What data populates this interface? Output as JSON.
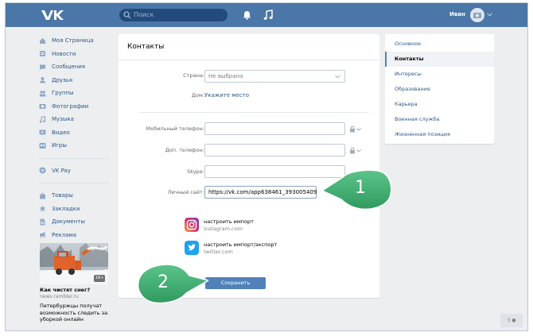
{
  "header": {
    "search_placeholder": "Поиск",
    "username": "Иван",
    "accent": "#4a76a8"
  },
  "leftnav": {
    "group1": [
      {
        "label": "Моя Страница",
        "icon": "home-icon"
      },
      {
        "label": "Новости",
        "icon": "news-icon"
      },
      {
        "label": "Сообщения",
        "icon": "messages-icon"
      },
      {
        "label": "Друзья",
        "icon": "friends-icon"
      },
      {
        "label": "Группы",
        "icon": "groups-icon"
      },
      {
        "label": "Фотографии",
        "icon": "camera-icon"
      },
      {
        "label": "Музыка",
        "icon": "music-icon"
      },
      {
        "label": "Видео",
        "icon": "video-icon"
      },
      {
        "label": "Игры",
        "icon": "games-icon"
      }
    ],
    "group2": [
      {
        "label": "VK Pay",
        "icon": "vkpay-icon"
      }
    ],
    "group3": [
      {
        "label": "Товары",
        "icon": "shopping-bag-icon"
      },
      {
        "label": "Закладки",
        "icon": "star-icon"
      },
      {
        "label": "Документы",
        "icon": "document-icon"
      },
      {
        "label": "Реклама",
        "icon": "megaphone-icon"
      }
    ]
  },
  "promo": {
    "badge": "18+",
    "title": "Как чистят снег?",
    "source": "news.rambler.ru",
    "text": "Петербуржцы получат возможность следить за уборкой онлайн"
  },
  "contacts": {
    "title": "Контакты",
    "country_label": "Страна:",
    "country_value": "Не выбрана",
    "home_label": "Дом:",
    "home_link": "Укажите место",
    "mobile_label": "Мобильный телефон:",
    "extra_phone_label": "Доп. телефон:",
    "skype_label": "Skype:",
    "site_label": "Личный сайт:",
    "site_value": "https://vk.com/app638461_393005409",
    "instagram_action": "настроить импорт",
    "instagram_name": "instagram.com",
    "twitter_action": "настроить импорт/экспорт",
    "twitter_name": "twitter.com",
    "save_label": "Сохранить"
  },
  "settings_menu": [
    {
      "label": "Основное",
      "active": false
    },
    {
      "label": "Контакты",
      "active": true
    },
    {
      "label": "Интересы",
      "active": false
    },
    {
      "label": "Образование",
      "active": false
    },
    {
      "label": "Карьера",
      "active": false
    },
    {
      "label": "Военная служба",
      "active": false
    },
    {
      "label": "Жизненная позиция",
      "active": false
    }
  ],
  "corner_counter": "3",
  "callouts": {
    "first": "1",
    "second": "2",
    "color": "#3aa56d"
  }
}
